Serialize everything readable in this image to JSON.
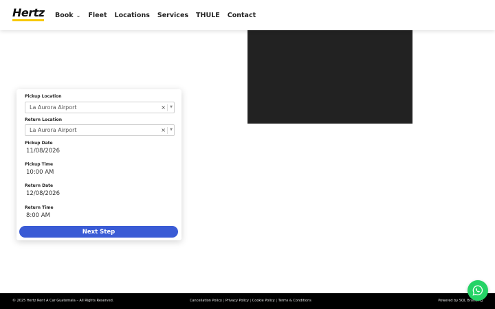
{
  "brand": {
    "logo_text": "Hertz",
    "accent": "#f7c800"
  },
  "nav": {
    "items": [
      {
        "label": "Book",
        "has_dropdown": true
      },
      {
        "label": "Fleet"
      },
      {
        "label": "Locations"
      },
      {
        "label": "Services"
      },
      {
        "label": "THULE"
      },
      {
        "label": "Contact"
      }
    ]
  },
  "booking": {
    "pickup_location": {
      "label": "Pickup Location",
      "value": "La Aurora Airport"
    },
    "return_location": {
      "label": "Return Location",
      "value": "La Aurora Airport"
    },
    "pickup_date": {
      "label": "Pickup Date",
      "value": "11/08/2026"
    },
    "pickup_time": {
      "label": "Pickup Time",
      "value": "10:00 AM"
    },
    "return_date": {
      "label": "Return Date",
      "value": "12/08/2026"
    },
    "return_time": {
      "label": "Return Time",
      "value": "8:00 AM"
    },
    "clear_symbol": "×",
    "button_label": "Next Step",
    "button_color": "#3a5bd5"
  },
  "footer": {
    "copyright": "© 2025 Hertz Rent A Car Guatemala – All Rights Reserved.",
    "links": [
      "Cancellation Policy",
      "Privacy Policy",
      "Cookie Policy",
      "Terms & Conditions"
    ],
    "separator": "|",
    "powered_by": "Powered by SQL Branding"
  },
  "whatsapp": {
    "icon": "whatsapp-icon",
    "color": "#25d366"
  }
}
